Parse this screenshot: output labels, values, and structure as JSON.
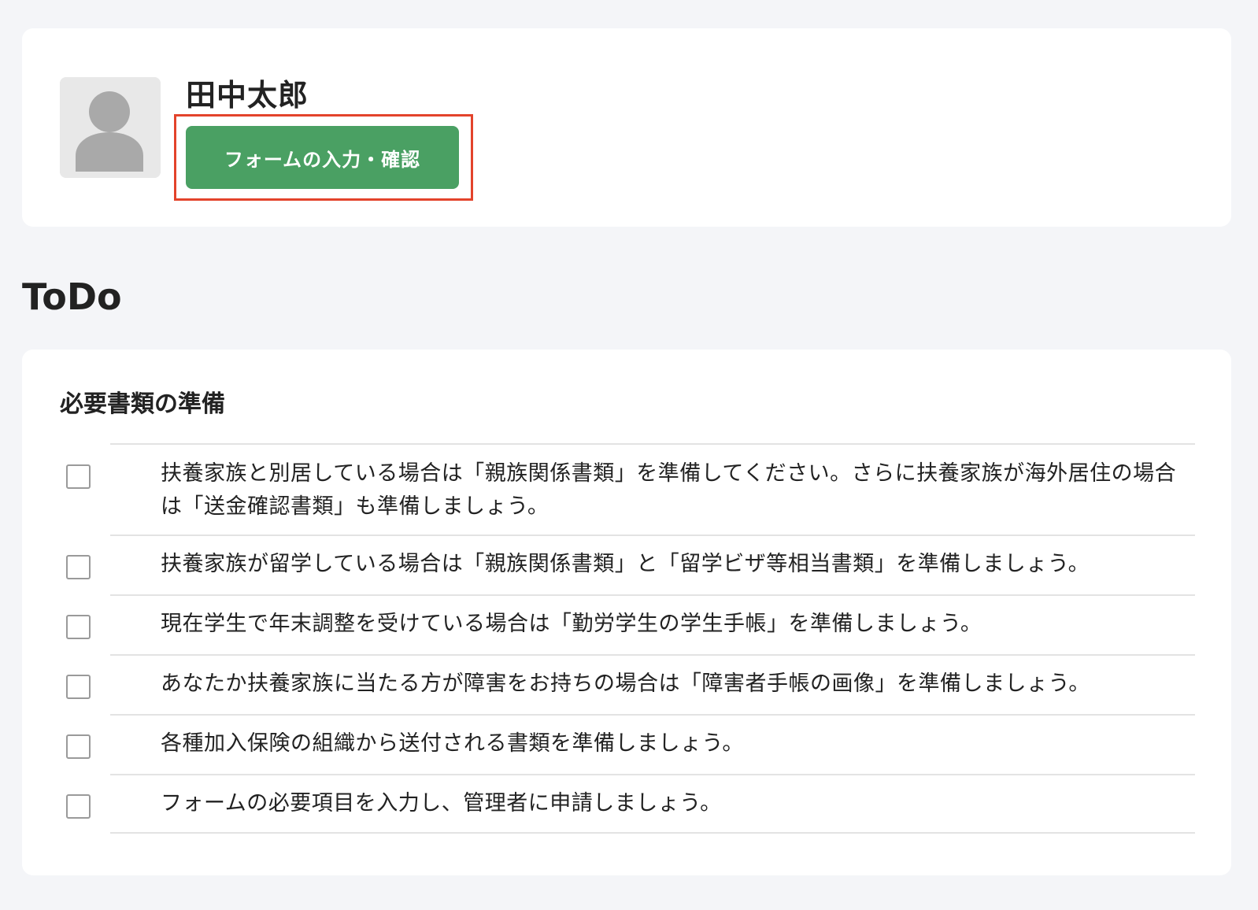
{
  "profile": {
    "name": "田中太郎",
    "form_button_label": "フォームの入力・確認"
  },
  "todo": {
    "title": "ToDo",
    "section_title": "必要書類の準備",
    "items": [
      {
        "text": "扶養家族と別居している場合は「親族関係書類」を準備してください。さらに扶養家族が海外居住の場合は「送金確認書類」も準備しましょう。",
        "checked": false
      },
      {
        "text": "扶養家族が留学している場合は「親族関係書類」と「留学ビザ等相当書類」を準備しましょう。",
        "checked": false
      },
      {
        "text": "現在学生で年末調整を受けている場合は「勤労学生の学生手帳」を準備しましょう。",
        "checked": false
      },
      {
        "text": "あなたか扶養家族に当たる方が障害をお持ちの場合は「障害者手帳の画像」を準備しましょう。",
        "checked": false
      },
      {
        "text": "各種加入保険の組織から送付される書類を準備しましょう。",
        "checked": false
      },
      {
        "text": "フォームの必要項目を入力し、管理者に申請しましょう。",
        "checked": false
      }
    ]
  },
  "colors": {
    "page_background": "#f4f5f8",
    "card_background": "#ffffff",
    "button_green": "#4aa063",
    "highlight_red": "#e3432b",
    "checkbox_border": "#9a9a9a"
  },
  "icons": {
    "avatar": "user-silhouette-icon"
  }
}
